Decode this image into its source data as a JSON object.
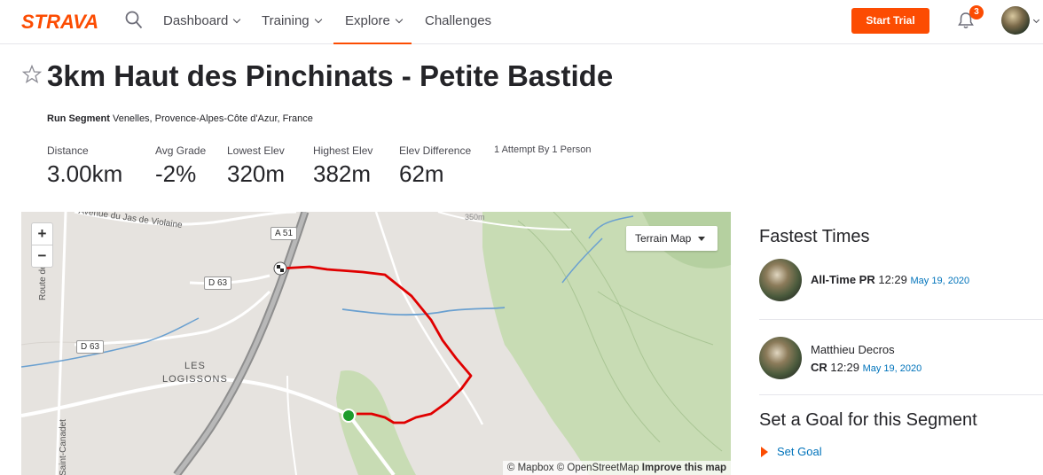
{
  "nav": {
    "logo": "STRAVA",
    "items": [
      {
        "label": "Dashboard",
        "has_chevron": true
      },
      {
        "label": "Training",
        "has_chevron": true
      },
      {
        "label": "Explore",
        "has_chevron": true,
        "active": true
      },
      {
        "label": "Challenges",
        "has_chevron": false
      }
    ],
    "start_trial": "Start Trial",
    "notification_count": "3",
    "icons": [
      "search-icon",
      "bell-icon",
      "avatar",
      "chevron-down-icon"
    ]
  },
  "segment": {
    "title": "3km Haut des Pinchinats - Petite Bastide",
    "type": "Run Segment",
    "location": "Venelles, Provence-Alpes-Côte d'Azur, France",
    "star_icon": "star-outline-icon"
  },
  "stats": [
    {
      "label": "Distance",
      "value": "3.00km"
    },
    {
      "label": "Avg Grade",
      "value": "-2%"
    },
    {
      "label": "Lowest Elev",
      "value": "320m"
    },
    {
      "label": "Highest Elev",
      "value": "382m"
    },
    {
      "label": "Elev Difference",
      "value": "62m"
    }
  ],
  "attempts": "1 Attempt By 1 Person",
  "map": {
    "zoom_in": "+",
    "zoom_out": "−",
    "terrain_select": "Terrain Map",
    "attribution_mapbox": "© Mapbox",
    "attribution_osm": "© OpenStreetMap",
    "attribution_improve": "Improve this map",
    "labels": {
      "avenue": "Avenue du Jas de Violaine",
      "route": "Route de Saint",
      "les": "LES",
      "logissons": "LOGISSONS",
      "saint_canadet": "Saint-Canadet",
      "contour": "350m"
    },
    "shields": [
      "A 51",
      "D 63",
      "D 63"
    ],
    "colors": {
      "route": "#e00000",
      "water": "#6aa0d0",
      "green": "#c8dcb4",
      "background": "#e6e3df"
    }
  },
  "fastest_times": {
    "heading": "Fastest Times",
    "entries": [
      {
        "label": "All-Time PR",
        "time": "12:29",
        "date": "May 19, 2020"
      },
      {
        "name": "Matthieu Decros",
        "label": "CR",
        "time": "12:29",
        "date": "May 19, 2020"
      }
    ]
  },
  "goal": {
    "heading": "Set a Goal for this Segment",
    "link": "Set Goal"
  },
  "colors": {
    "brand": "#fc4c02",
    "link": "#0073bb",
    "text": "#242428"
  }
}
